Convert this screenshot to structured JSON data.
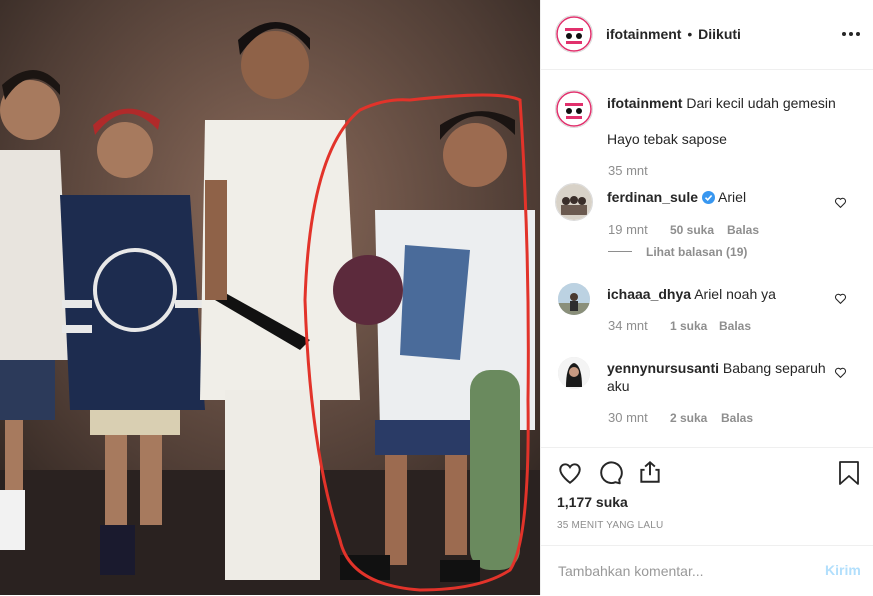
{
  "post": {
    "username": "ifotainment",
    "separator": "•",
    "follow_status": "Diikuti",
    "options_icon": "more-horizontal-icon"
  },
  "caption": {
    "username": "ifotainment",
    "line1": "Dari kecil udah gemesin",
    "line2": "Hayo tebak sapose",
    "time": "35 mnt"
  },
  "comments": [
    {
      "username": "ferdinan_sule",
      "verified": true,
      "text": "Ariel",
      "time": "19 mnt",
      "likes": "50 suka",
      "reply": "Balas",
      "view_replies": "Lihat balasan (19)"
    },
    {
      "username": "ichaaa_dhya",
      "text": "Ariel noah ya",
      "time": "34 mnt",
      "likes": "1 suka",
      "reply": "Balas"
    },
    {
      "username": "yennynursusanti",
      "text_line1": "Babang separuh",
      "text_line2": "aku",
      "time": "30 mnt",
      "likes": "2 suka",
      "reply": "Balas"
    }
  ],
  "actions": {
    "likes": "1,177 suka",
    "timestamp": "35 MENIT YANG LALU"
  },
  "comment_box": {
    "placeholder": "Tambahkan komentar...",
    "submit": "Kirim"
  },
  "colors": {
    "verified": "#3897f0",
    "link_disabled": "#b2dffc",
    "highlight_circle": "#e2332a"
  }
}
